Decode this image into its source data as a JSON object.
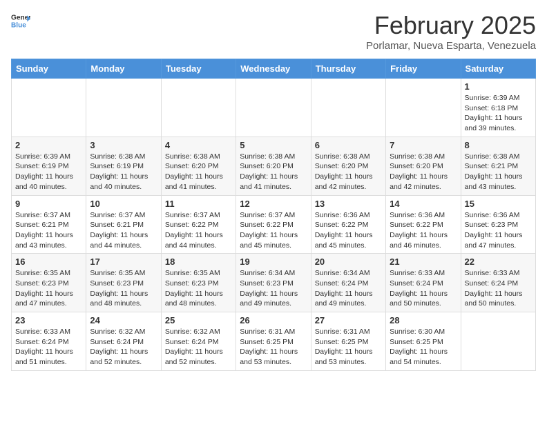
{
  "header": {
    "logo_general": "General",
    "logo_blue": "Blue",
    "title": "February 2025",
    "location": "Porlamar, Nueva Esparta, Venezuela"
  },
  "weekdays": [
    "Sunday",
    "Monday",
    "Tuesday",
    "Wednesday",
    "Thursday",
    "Friday",
    "Saturday"
  ],
  "weeks": [
    [
      {
        "day": "",
        "info": ""
      },
      {
        "day": "",
        "info": ""
      },
      {
        "day": "",
        "info": ""
      },
      {
        "day": "",
        "info": ""
      },
      {
        "day": "",
        "info": ""
      },
      {
        "day": "",
        "info": ""
      },
      {
        "day": "1",
        "info": "Sunrise: 6:39 AM\nSunset: 6:18 PM\nDaylight: 11 hours\nand 39 minutes."
      }
    ],
    [
      {
        "day": "2",
        "info": "Sunrise: 6:39 AM\nSunset: 6:19 PM\nDaylight: 11 hours\nand 40 minutes."
      },
      {
        "day": "3",
        "info": "Sunrise: 6:38 AM\nSunset: 6:19 PM\nDaylight: 11 hours\nand 40 minutes."
      },
      {
        "day": "4",
        "info": "Sunrise: 6:38 AM\nSunset: 6:20 PM\nDaylight: 11 hours\nand 41 minutes."
      },
      {
        "day": "5",
        "info": "Sunrise: 6:38 AM\nSunset: 6:20 PM\nDaylight: 11 hours\nand 41 minutes."
      },
      {
        "day": "6",
        "info": "Sunrise: 6:38 AM\nSunset: 6:20 PM\nDaylight: 11 hours\nand 42 minutes."
      },
      {
        "day": "7",
        "info": "Sunrise: 6:38 AM\nSunset: 6:20 PM\nDaylight: 11 hours\nand 42 minutes."
      },
      {
        "day": "8",
        "info": "Sunrise: 6:38 AM\nSunset: 6:21 PM\nDaylight: 11 hours\nand 43 minutes."
      }
    ],
    [
      {
        "day": "9",
        "info": "Sunrise: 6:37 AM\nSunset: 6:21 PM\nDaylight: 11 hours\nand 43 minutes."
      },
      {
        "day": "10",
        "info": "Sunrise: 6:37 AM\nSunset: 6:21 PM\nDaylight: 11 hours\nand 44 minutes."
      },
      {
        "day": "11",
        "info": "Sunrise: 6:37 AM\nSunset: 6:22 PM\nDaylight: 11 hours\nand 44 minutes."
      },
      {
        "day": "12",
        "info": "Sunrise: 6:37 AM\nSunset: 6:22 PM\nDaylight: 11 hours\nand 45 minutes."
      },
      {
        "day": "13",
        "info": "Sunrise: 6:36 AM\nSunset: 6:22 PM\nDaylight: 11 hours\nand 45 minutes."
      },
      {
        "day": "14",
        "info": "Sunrise: 6:36 AM\nSunset: 6:22 PM\nDaylight: 11 hours\nand 46 minutes."
      },
      {
        "day": "15",
        "info": "Sunrise: 6:36 AM\nSunset: 6:23 PM\nDaylight: 11 hours\nand 47 minutes."
      }
    ],
    [
      {
        "day": "16",
        "info": "Sunrise: 6:35 AM\nSunset: 6:23 PM\nDaylight: 11 hours\nand 47 minutes."
      },
      {
        "day": "17",
        "info": "Sunrise: 6:35 AM\nSunset: 6:23 PM\nDaylight: 11 hours\nand 48 minutes."
      },
      {
        "day": "18",
        "info": "Sunrise: 6:35 AM\nSunset: 6:23 PM\nDaylight: 11 hours\nand 48 minutes."
      },
      {
        "day": "19",
        "info": "Sunrise: 6:34 AM\nSunset: 6:23 PM\nDaylight: 11 hours\nand 49 minutes."
      },
      {
        "day": "20",
        "info": "Sunrise: 6:34 AM\nSunset: 6:24 PM\nDaylight: 11 hours\nand 49 minutes."
      },
      {
        "day": "21",
        "info": "Sunrise: 6:33 AM\nSunset: 6:24 PM\nDaylight: 11 hours\nand 50 minutes."
      },
      {
        "day": "22",
        "info": "Sunrise: 6:33 AM\nSunset: 6:24 PM\nDaylight: 11 hours\nand 50 minutes."
      }
    ],
    [
      {
        "day": "23",
        "info": "Sunrise: 6:33 AM\nSunset: 6:24 PM\nDaylight: 11 hours\nand 51 minutes."
      },
      {
        "day": "24",
        "info": "Sunrise: 6:32 AM\nSunset: 6:24 PM\nDaylight: 11 hours\nand 52 minutes."
      },
      {
        "day": "25",
        "info": "Sunrise: 6:32 AM\nSunset: 6:24 PM\nDaylight: 11 hours\nand 52 minutes."
      },
      {
        "day": "26",
        "info": "Sunrise: 6:31 AM\nSunset: 6:25 PM\nDaylight: 11 hours\nand 53 minutes."
      },
      {
        "day": "27",
        "info": "Sunrise: 6:31 AM\nSunset: 6:25 PM\nDaylight: 11 hours\nand 53 minutes."
      },
      {
        "day": "28",
        "info": "Sunrise: 6:30 AM\nSunset: 6:25 PM\nDaylight: 11 hours\nand 54 minutes."
      },
      {
        "day": "",
        "info": ""
      }
    ]
  ]
}
